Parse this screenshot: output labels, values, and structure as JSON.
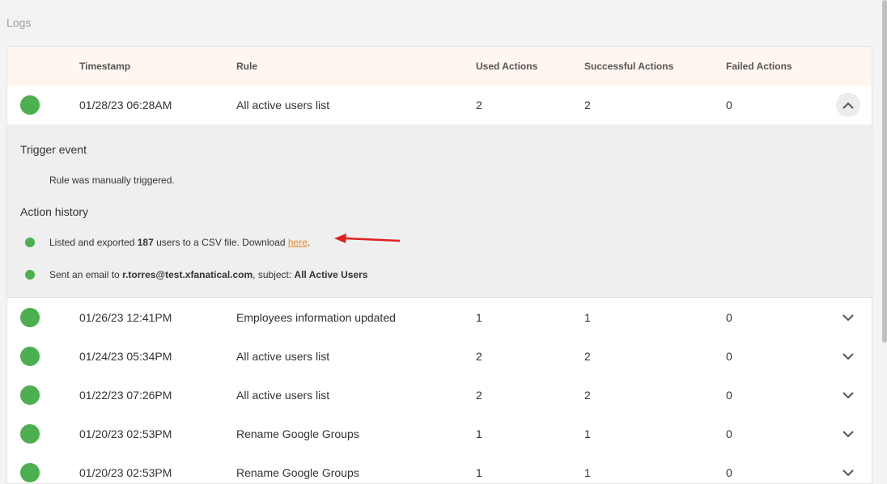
{
  "page": {
    "title": "Logs"
  },
  "table": {
    "headers": {
      "timestamp": "Timestamp",
      "rule": "Rule",
      "used": "Used Actions",
      "successful": "Successful Actions",
      "failed": "Failed Actions"
    },
    "rows": [
      {
        "timestamp": "01/28/23 06:28AM",
        "rule": "All active users list",
        "used": "2",
        "successful": "2",
        "failed": "0",
        "expanded": true
      },
      {
        "timestamp": "01/26/23 12:41PM",
        "rule": "Employees information updated",
        "used": "1",
        "successful": "1",
        "failed": "0"
      },
      {
        "timestamp": "01/24/23 05:34PM",
        "rule": "All active users list",
        "used": "2",
        "successful": "2",
        "failed": "0"
      },
      {
        "timestamp": "01/22/23 07:26PM",
        "rule": "All active users list",
        "used": "2",
        "successful": "2",
        "failed": "0"
      },
      {
        "timestamp": "01/20/23 02:53PM",
        "rule": "Rename Google Groups",
        "used": "1",
        "successful": "1",
        "failed": "0"
      },
      {
        "timestamp": "01/20/23 02:53PM",
        "rule": "Rename Google Groups",
        "used": "1",
        "successful": "1",
        "failed": "0"
      }
    ]
  },
  "details": {
    "trigger_title": "Trigger event",
    "trigger_text": "Rule was manually triggered.",
    "history_title": "Action history",
    "action1": {
      "prefix": "Listed and exported ",
      "count": "187",
      "middle": " users to a CSV file. Download ",
      "link": "here",
      "suffix": "."
    },
    "action2": {
      "prefix": "Sent an email to ",
      "email": "r.torres@test.xfanatical.com",
      "middle": ", subject: ",
      "subject": "All Active Users"
    }
  },
  "colors": {
    "status_success": "#4caf50",
    "header_bg": "#fff6ef",
    "link": "#e98a2c",
    "annotation_arrow": "#e02020"
  },
  "icons": {
    "expand": "chevron-down-icon",
    "collapse": "chevron-up-icon"
  }
}
